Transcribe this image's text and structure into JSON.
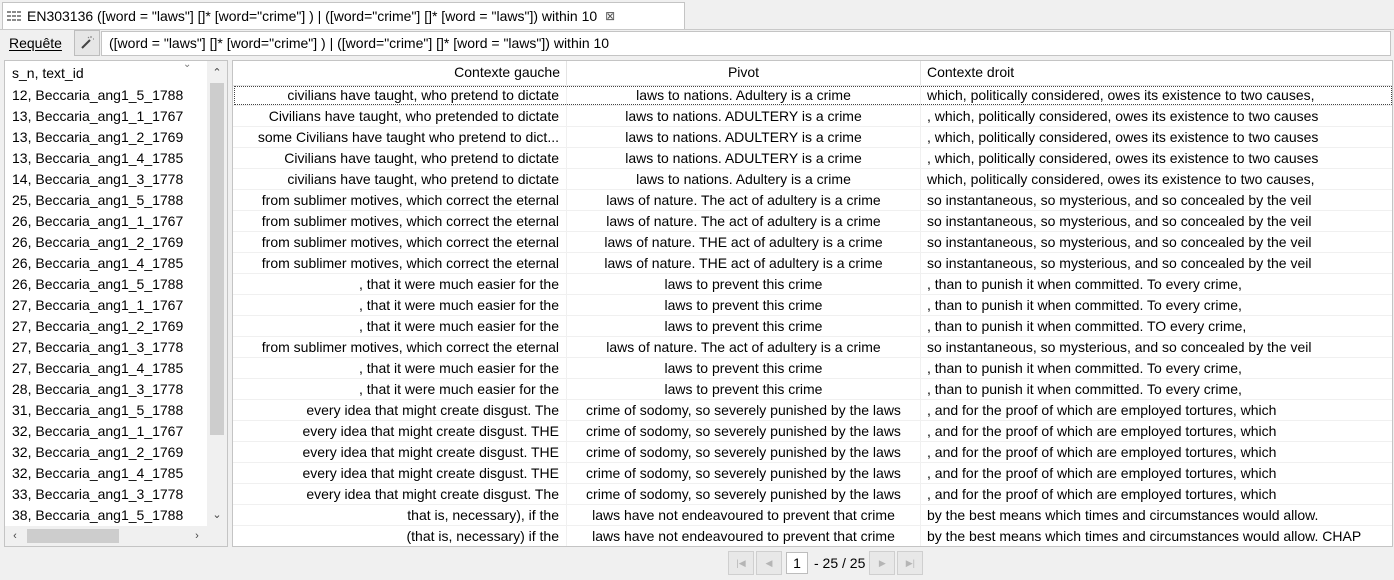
{
  "tab": {
    "title": "EN303136 ([word = \"laws\"] []* [word=\"crime\"] ) | ([word=\"crime\"]  []* [word = \"laws\"]) within 10",
    "close_glyph": "⊠"
  },
  "query": {
    "label": "Requête",
    "value": "([word = \"laws\"] []* [word=\"crime\"] ) | ([word=\"crime\"]  []* [word = \"laws\"]) within 10"
  },
  "left_panel": {
    "header": "s_n, text_id",
    "rows": [
      "12, Beccaria_ang1_5_1788",
      "13, Beccaria_ang1_1_1767",
      "13, Beccaria_ang1_2_1769",
      "13, Beccaria_ang1_4_1785",
      "14, Beccaria_ang1_3_1778",
      "25, Beccaria_ang1_5_1788",
      "26, Beccaria_ang1_1_1767",
      "26, Beccaria_ang1_2_1769",
      "26, Beccaria_ang1_4_1785",
      "26, Beccaria_ang1_5_1788",
      "27, Beccaria_ang1_1_1767",
      "27, Beccaria_ang1_2_1769",
      "27, Beccaria_ang1_3_1778",
      "27, Beccaria_ang1_4_1785",
      "28, Beccaria_ang1_3_1778",
      "31, Beccaria_ang1_5_1788",
      "32, Beccaria_ang1_1_1767",
      "32, Beccaria_ang1_2_1769",
      "32, Beccaria_ang1_4_1785",
      "33, Beccaria_ang1_3_1778",
      "38, Beccaria_ang1_5_1788"
    ]
  },
  "table": {
    "headers": {
      "left": "Contexte gauche",
      "pivot": "Pivot",
      "right": "Contexte droit"
    },
    "rows": [
      {
        "left": "civilians have taught, who pretend to dictate",
        "pivot": "laws to nations. Adultery is a crime",
        "right": "which, politically considered, owes its existence to two causes,"
      },
      {
        "left": "Civilians have taught, who pretended to dictate",
        "pivot": "laws to nations. ADULTERY is a crime",
        "right": ", which, politically considered, owes its existence to two causes"
      },
      {
        "left": "some Civilians have taught who pretend to dict...",
        "pivot": "laws to nations. ADULTERY is a crime",
        "right": ", which, politically considered, owes its existence to two causes"
      },
      {
        "left": "Civilians have taught, who pretend to dictate",
        "pivot": "laws to nations. ADULTERY is a crime",
        "right": ", which, politically considered, owes its existence to two causes"
      },
      {
        "left": "civilians have taught, who pretend to dictate",
        "pivot": "laws to nations. Adultery is a crime",
        "right": "which, politically considered, owes its existence to two causes,"
      },
      {
        "left": "from sublimer motives, which correct the eternal",
        "pivot": "laws of nature. The act of adultery is a crime",
        "right": "so instantaneous, so mysterious, and so concealed by the veil"
      },
      {
        "left": "from sublimer motives, which correct the eternal",
        "pivot": "laws of nature. The act of adultery is a crime",
        "right": "so instantaneous, so mysterious, and so concealed by the veil"
      },
      {
        "left": "from sublimer motives, which correct the eternal",
        "pivot": "laws of nature. THE act of adultery is a crime",
        "right": "so instantaneous, so mysterious, and so concealed by the veil"
      },
      {
        "left": "from sublimer motives, which correct the eternal",
        "pivot": "laws of nature. THE act of adultery is a crime",
        "right": "so instantaneous, so mysterious, and so concealed by the veil"
      },
      {
        "left": ", that it were much easier for the",
        "pivot": "laws to prevent this crime",
        "right": ", than to punish it when committed. To every crime,"
      },
      {
        "left": ", that it were much easier for the",
        "pivot": "laws to prevent this crime",
        "right": ", than to punish it when committed. To every crime,"
      },
      {
        "left": ", that it were much easier for the",
        "pivot": "laws to prevent this crime",
        "right": ", than to punish it when committed. TO every crime,"
      },
      {
        "left": "from sublimer motives, which correct the eternal",
        "pivot": "laws of nature. The act of adultery is a crime",
        "right": "so instantaneous, so mysterious, and so concealed by the veil"
      },
      {
        "left": ", that it were much easier for the",
        "pivot": "laws to prevent this crime",
        "right": ", than to punish it when committed. To every crime,"
      },
      {
        "left": ", that it were much easier for the",
        "pivot": "laws to prevent this crime",
        "right": ", than to punish it when committed. To every crime,"
      },
      {
        "left": "every idea that might create disgust. The",
        "pivot": "crime of sodomy, so severely punished by the laws",
        "right": ", and for the proof of which are employed tortures, which"
      },
      {
        "left": "every idea that might create disgust. THE",
        "pivot": "crime of sodomy, so severely punished by the laws",
        "right": ", and for the proof of which are employed tortures, which"
      },
      {
        "left": "every idea that might create disgust. THE",
        "pivot": "crime of sodomy, so severely punished by the laws",
        "right": ", and for the proof of which are employed tortures, which"
      },
      {
        "left": "every idea that might create disgust. THE",
        "pivot": "crime of sodomy, so severely punished by the laws",
        "right": ", and for the proof of which are employed tortures, which"
      },
      {
        "left": "every idea that might create disgust. The",
        "pivot": "crime of sodomy, so severely punished by the laws",
        "right": ", and for the proof of which are employed tortures, which"
      },
      {
        "left": "that is, necessary), if the",
        "pivot": "laws have not endeavoured to prevent that crime",
        "right": "by the best means which times and circumstances would allow."
      },
      {
        "left": "(that is, necessary) if the",
        "pivot": "laws have not endeavoured to prevent that crime",
        "right": "by the best means which times and circumstances would allow. CHAP"
      }
    ]
  },
  "pagination": {
    "current_page": "1",
    "range_text": "- 25 / 25"
  },
  "icons": {
    "tab": "table-grid-icon",
    "close": "close-icon",
    "query_action": "magic-wand-icon",
    "first": "first-page-icon",
    "prev": "previous-page-icon",
    "next": "next-page-icon",
    "last": "last-page-icon"
  }
}
